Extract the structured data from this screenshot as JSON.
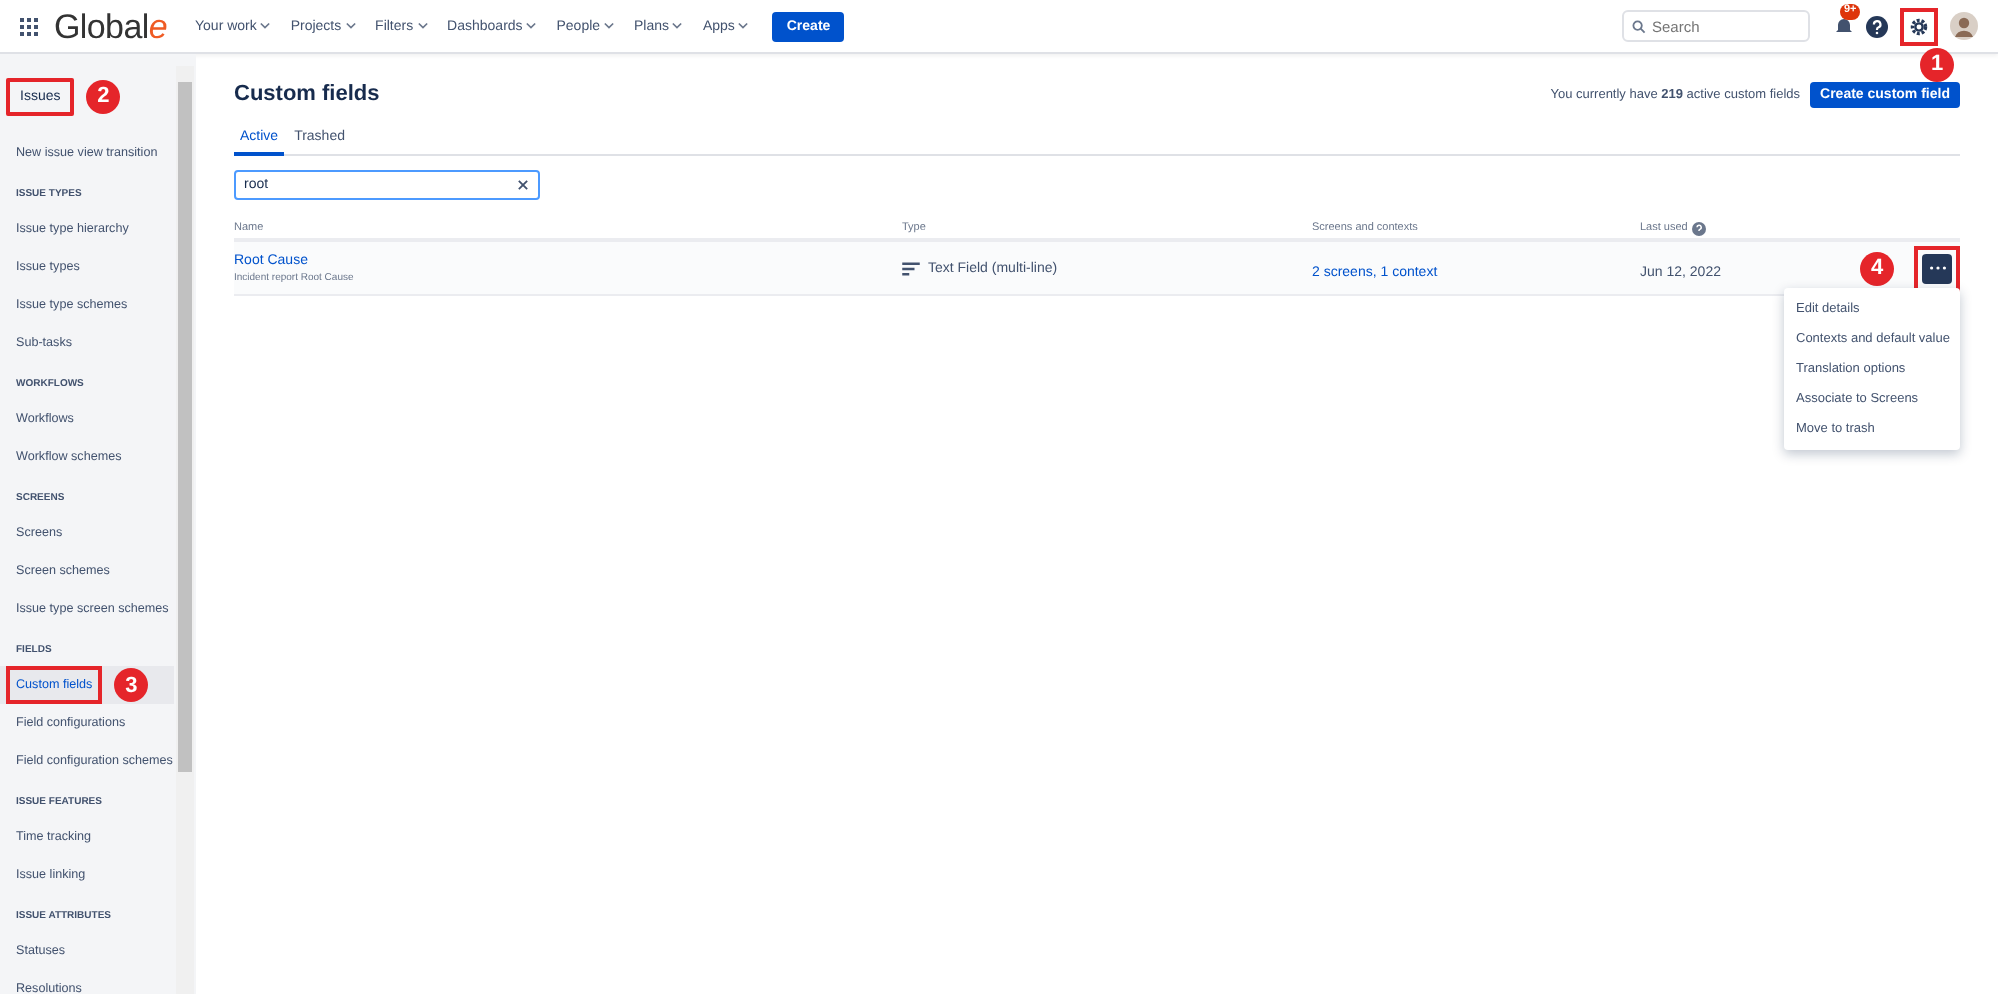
{
  "topbar": {
    "logo": {
      "text": "Global",
      "accent": "e"
    },
    "nav": [
      {
        "label": "Your work"
      },
      {
        "label": "Projects"
      },
      {
        "label": "Filters"
      },
      {
        "label": "Dashboards"
      },
      {
        "label": "People"
      },
      {
        "label": "Plans"
      },
      {
        "label": "Apps"
      }
    ],
    "create_button": "Create",
    "search": {
      "placeholder": "Search"
    },
    "notifications_badge": "9+",
    "settings_callout": "1"
  },
  "sidebar": {
    "title": "Issues",
    "title_callout": "2",
    "items": [
      {
        "kind": "link",
        "label": "New issue view transition",
        "selected": false
      },
      {
        "kind": "heading",
        "label": "ISSUE TYPES"
      },
      {
        "kind": "link",
        "label": "Issue type hierarchy",
        "selected": false
      },
      {
        "kind": "link",
        "label": "Issue types",
        "selected": false
      },
      {
        "kind": "link",
        "label": "Issue type schemes",
        "selected": false
      },
      {
        "kind": "link",
        "label": "Sub-tasks",
        "selected": false
      },
      {
        "kind": "heading",
        "label": "WORKFLOWS"
      },
      {
        "kind": "link",
        "label": "Workflows",
        "selected": false
      },
      {
        "kind": "link",
        "label": "Workflow schemes",
        "selected": false
      },
      {
        "kind": "heading",
        "label": "SCREENS"
      },
      {
        "kind": "link",
        "label": "Screens",
        "selected": false
      },
      {
        "kind": "link",
        "label": "Screen schemes",
        "selected": false
      },
      {
        "kind": "link",
        "label": "Issue type screen schemes",
        "selected": false
      },
      {
        "kind": "heading",
        "label": "FIELDS"
      },
      {
        "kind": "link",
        "label": "Custom fields",
        "selected": true,
        "callout": "3"
      },
      {
        "kind": "link",
        "label": "Field configurations",
        "selected": false
      },
      {
        "kind": "link",
        "label": "Field configuration schemes",
        "selected": false
      },
      {
        "kind": "heading",
        "label": "ISSUE FEATURES"
      },
      {
        "kind": "link",
        "label": "Time tracking",
        "selected": false
      },
      {
        "kind": "link",
        "label": "Issue linking",
        "selected": false
      },
      {
        "kind": "heading",
        "label": "ISSUE ATTRIBUTES"
      },
      {
        "kind": "link",
        "label": "Statuses",
        "selected": false
      },
      {
        "kind": "link",
        "label": "Resolutions",
        "selected": false
      }
    ]
  },
  "page": {
    "title": "Custom fields",
    "count_text": "You currently have **219** active custom fields",
    "create_button": "Create custom field",
    "tabs": [
      {
        "label": "Active",
        "selected": true
      },
      {
        "label": "Trashed",
        "selected": false
      }
    ],
    "filter": {
      "value": "root"
    },
    "table": {
      "columns": [
        "Name",
        "Type",
        "Screens and contexts",
        "Last used"
      ],
      "rows": [
        {
          "name": "Root Cause",
          "description": "Incident report Root Cause",
          "type": "Text Field (multi-line)",
          "screens": "2 screens, 1 context",
          "last_used": "Jun 12, 2022",
          "actions_callout": "4"
        }
      ]
    },
    "actions_menu": [
      "Edit details",
      "Contexts and default value",
      "Translation options",
      "Associate to Screens",
      "Move to trash"
    ]
  }
}
